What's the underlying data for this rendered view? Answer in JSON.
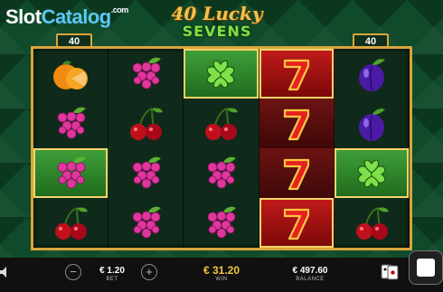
{
  "watermark": {
    "part1": "Slot",
    "part2": "Catalog",
    "suffix": ".com"
  },
  "logo": {
    "line1": "40 Lucky",
    "line2": "SEVENS"
  },
  "paylines": {
    "left": "40",
    "right": "40"
  },
  "reels": [
    [
      "orange",
      "grapes",
      "grapes",
      "cherry"
    ],
    [
      "grapes",
      "cherry",
      "grapes",
      "grapes"
    ],
    [
      "clover",
      "cherry",
      "grapes",
      "grapes"
    ],
    [
      "seven",
      "seven",
      "seven",
      "seven"
    ],
    [
      "plum",
      "plum",
      "clover",
      "cherry"
    ]
  ],
  "highlights": [
    {
      "reel": 2,
      "row": 0,
      "type": "green"
    },
    {
      "reel": 0,
      "row": 2,
      "type": "green"
    },
    {
      "reel": 4,
      "row": 2,
      "type": "green"
    },
    {
      "reel": 3,
      "row": 0,
      "type": "red"
    },
    {
      "reel": 3,
      "row": 3,
      "type": "red"
    }
  ],
  "bottom_bar": {
    "bet_value": "€ 1.20",
    "bet_label": "BET",
    "win_value": "€ 31.20",
    "win_label": "WIN",
    "balance_value": "€ 497.60",
    "balance_label": "BALANCE",
    "minus_label": "−",
    "plus_label": "+"
  },
  "icons": [
    "sound-icon",
    "minus-icon",
    "plus-icon",
    "cards-icon",
    "spin-icon"
  ],
  "colors": {
    "gold": "#d9a53b",
    "win": "#f5c842",
    "accent_green": "#7ee04a"
  }
}
